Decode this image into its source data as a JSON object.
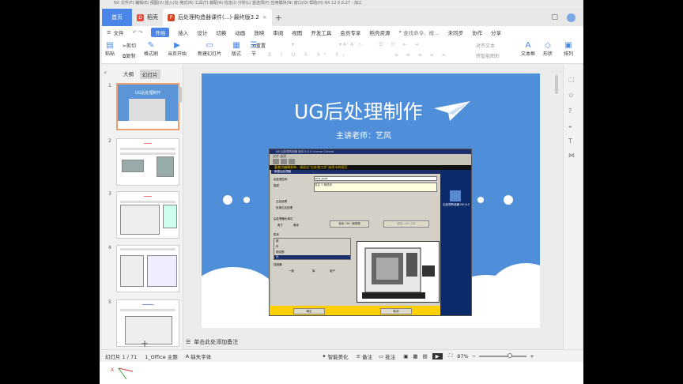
{
  "app": {
    "home_tab": "首页",
    "tabs": [
      {
        "icon": "doc-icon",
        "label": "稻壳"
      },
      {
        "icon": "ppt-icon",
        "label": "后处理构造器课件(...)-最终版3.2"
      }
    ],
    "bg_menu_text": "NX  文件(F)  编辑(E)  视图(V)  插入(S)  格式(R)  工具(T)  装配(A)  信息(I)  分析(L)  首选项(P)  应用模块(N)  窗口(O)  帮助(H)    NX 12.0.0.27 - 加工"
  },
  "menu": [
    "文件",
    "开始",
    "插入",
    "设计",
    "切换",
    "动画",
    "放映",
    "审阅",
    "视图",
    "开发工具",
    "会员专享",
    "稻壳资源"
  ],
  "menu_active": "开始",
  "menu_search": "查找命令、搜…",
  "menu_right": [
    "未同步",
    "协作",
    "分享"
  ],
  "ribbon": {
    "paste": "粘贴",
    "cut": "剪切",
    "copy": "复制",
    "format_painter": "格式刷",
    "start_from_current": "当页开始",
    "new_slide": "新建幻灯片",
    "layout": "版式",
    "section": "节",
    "reset": "重置",
    "align_text": "对齐文本",
    "convert_smartart": "转智能图形",
    "textbox": "文本框",
    "shape": "形状",
    "arrange": "排列"
  },
  "panel": {
    "tab_outline": "大纲",
    "tab_slides": "幻灯片",
    "thumb_numbers": [
      "1",
      "2",
      "3",
      "4",
      "5"
    ],
    "thumb1_title": "UG后处理制作"
  },
  "slide": {
    "title": "UG后处理制作",
    "subtitle": "主讲老师：艺风"
  },
  "embed": {
    "window_title": "NX 后处理构造器 版本 8.0.0   License Control",
    "menu": "文件    选项",
    "banner": "要激活编辑表单，请双击“后处理工作”选项卡的项目",
    "dialog_title": "新建后处理器",
    "lbl_name": "后处理名称",
    "val_name": "new_post",
    "lbl_desc": "描述",
    "val_desc": "设定 3 轴铣床",
    "opt_main": "主后处理",
    "opt_sub": "仅单位后处理",
    "lbl_units": "后处理输出单位",
    "unit_in": "英寸",
    "unit_mm": "毫米",
    "btn_use_ude": "使用 CNC 编辑器",
    "btn_link": "链接 UDE 文件",
    "lbl_machine": "机床",
    "machine_opts": [
      "铣",
      "车",
      "线切割",
      "孔"
    ],
    "lbl_controller": "控制器",
    "ctrl_opts": [
      "一般",
      "库",
      "用户"
    ],
    "btn_ok": "确定",
    "btn_cancel": "取消",
    "desktop_icon": "后处理构造器 NX 8.0"
  },
  "notes": "单击此处添加备注",
  "status": {
    "slide_count": "幻灯片 1 / 71",
    "theme": "1_Office 主题",
    "missing_font": "缺失字体",
    "beautify": "智能美化",
    "notes_btn": "备注",
    "comment": "批注",
    "zoom": "87%"
  }
}
